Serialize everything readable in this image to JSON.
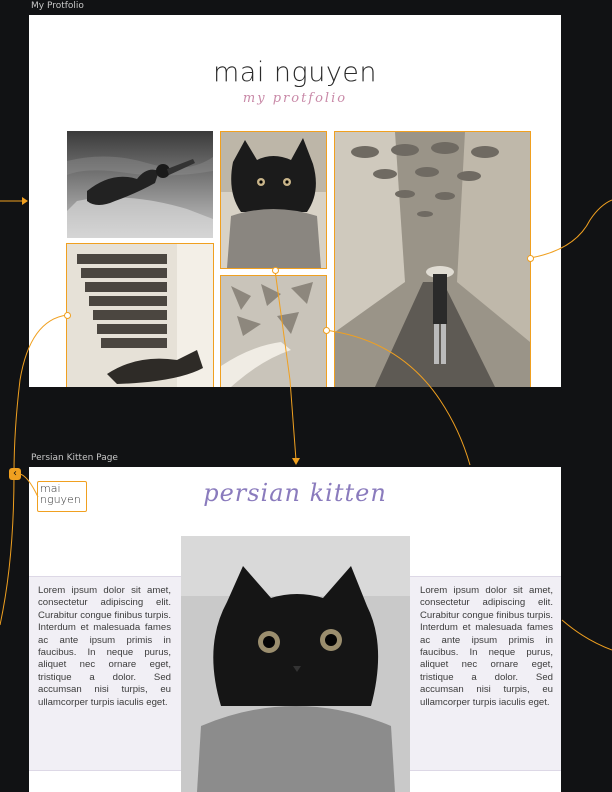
{
  "frames": {
    "portfolio": {
      "label": "My Protfolio"
    },
    "kitten": {
      "label": "Persian Kitten Page"
    }
  },
  "portfolio": {
    "title": "mai nguyen",
    "subtitle": "my protfolio"
  },
  "kitten_page": {
    "logo_line1": "mai",
    "logo_line2": "nguyen",
    "title": "persian kitten",
    "left_text": "Lorem ipsum dolor sit amet, consectetur adipiscing elit. Curabitur congue finibus turpis. Interdum et malesuada fames ac ante ipsum primis in faucibus. In neque purus, aliquet nec ornare eget, tristique a dolor. Sed accumsan nisi turpis, eu ullamcorper turpis iaculis eget.",
    "right_text": "Lorem ipsum dolor sit amet, consectetur adipiscing elit. Curabitur congue finibus turpis. Interdum et malesuada fames ac ante ipsum primis in faucibus. In neque purus, aliquet nec ornare eget, tristique a dolor. Sed accumsan nisi turpis, eu ullamcorper turpis iaculis eget."
  },
  "colors": {
    "canvas": "#111214",
    "connection": "#f0a020",
    "script_pink": "#c98aa8",
    "script_purple": "#8a7bbd"
  },
  "icons": {
    "back_link": "chevron-left-icon"
  }
}
